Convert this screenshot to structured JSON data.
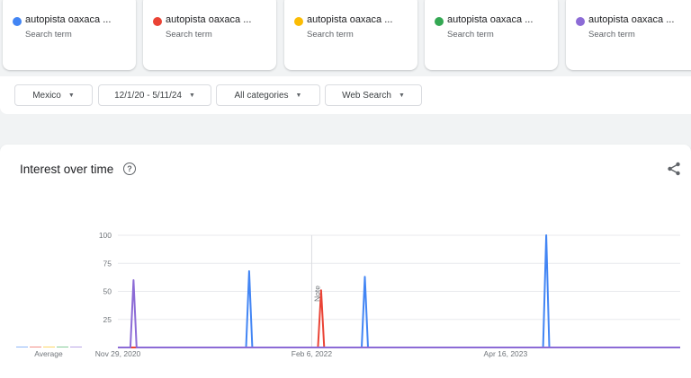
{
  "search_terms": [
    {
      "label": "autopista oaxaca ...",
      "sub": "Search term",
      "color": "#4285f4"
    },
    {
      "label": "autopista oaxaca ...",
      "sub": "Search term",
      "color": "#ea4335"
    },
    {
      "label": "autopista oaxaca ...",
      "sub": "Search term",
      "color": "#fbbc04"
    },
    {
      "label": "autopista oaxaca ...",
      "sub": "Search term",
      "color": "#34a853"
    },
    {
      "label": "autopista oaxaca ...",
      "sub": "Search term",
      "color": "#8c6bd6"
    }
  ],
  "filters": {
    "region": "Mexico",
    "date_range": "12/1/20 - 5/11/24",
    "category": "All categories",
    "property": "Web Search"
  },
  "card": {
    "title": "Interest over time",
    "average_label": "Average",
    "note_label": "Note"
  },
  "chart_data": {
    "type": "line",
    "title": "Interest over time",
    "x_tick_labels": [
      "Nov 29, 2020",
      "Feb 6, 2022",
      "Apr 16, 2023"
    ],
    "x_range": [
      "2020-11-29",
      "2024-05-11"
    ],
    "ylim": [
      0,
      100
    ],
    "y_ticks": [
      25,
      50,
      75,
      100
    ],
    "grid": true,
    "note_marker_date": "2022-02-06",
    "series": [
      {
        "color": "#4285f4",
        "points": [
          [
            "2020-11-29",
            0
          ],
          [
            "2021-09-12",
            0
          ],
          [
            "2021-09-19",
            68
          ],
          [
            "2021-09-26",
            0
          ],
          [
            "2022-05-29",
            0
          ],
          [
            "2022-06-05",
            63
          ],
          [
            "2022-06-12",
            0
          ],
          [
            "2023-07-09",
            0
          ],
          [
            "2023-07-16",
            100
          ],
          [
            "2023-07-23",
            0
          ],
          [
            "2024-05-11",
            0
          ]
        ]
      },
      {
        "color": "#ea4335",
        "points": [
          [
            "2020-11-29",
            0
          ],
          [
            "2022-02-20",
            0
          ],
          [
            "2022-02-27",
            51
          ],
          [
            "2022-03-06",
            0
          ],
          [
            "2024-05-11",
            0
          ]
        ]
      },
      {
        "color": "#fbbc04",
        "points": [
          [
            "2020-11-29",
            0
          ],
          [
            "2024-05-11",
            0
          ]
        ]
      },
      {
        "color": "#34a853",
        "points": [
          [
            "2020-11-29",
            0
          ],
          [
            "2024-05-11",
            0
          ]
        ]
      },
      {
        "color": "#8c6bd6",
        "points": [
          [
            "2020-11-29",
            0
          ],
          [
            "2020-12-27",
            0
          ],
          [
            "2021-01-03",
            60
          ],
          [
            "2021-01-10",
            0
          ],
          [
            "2024-05-11",
            0
          ]
        ]
      }
    ],
    "average": [
      0,
      0,
      0,
      0,
      0
    ]
  }
}
